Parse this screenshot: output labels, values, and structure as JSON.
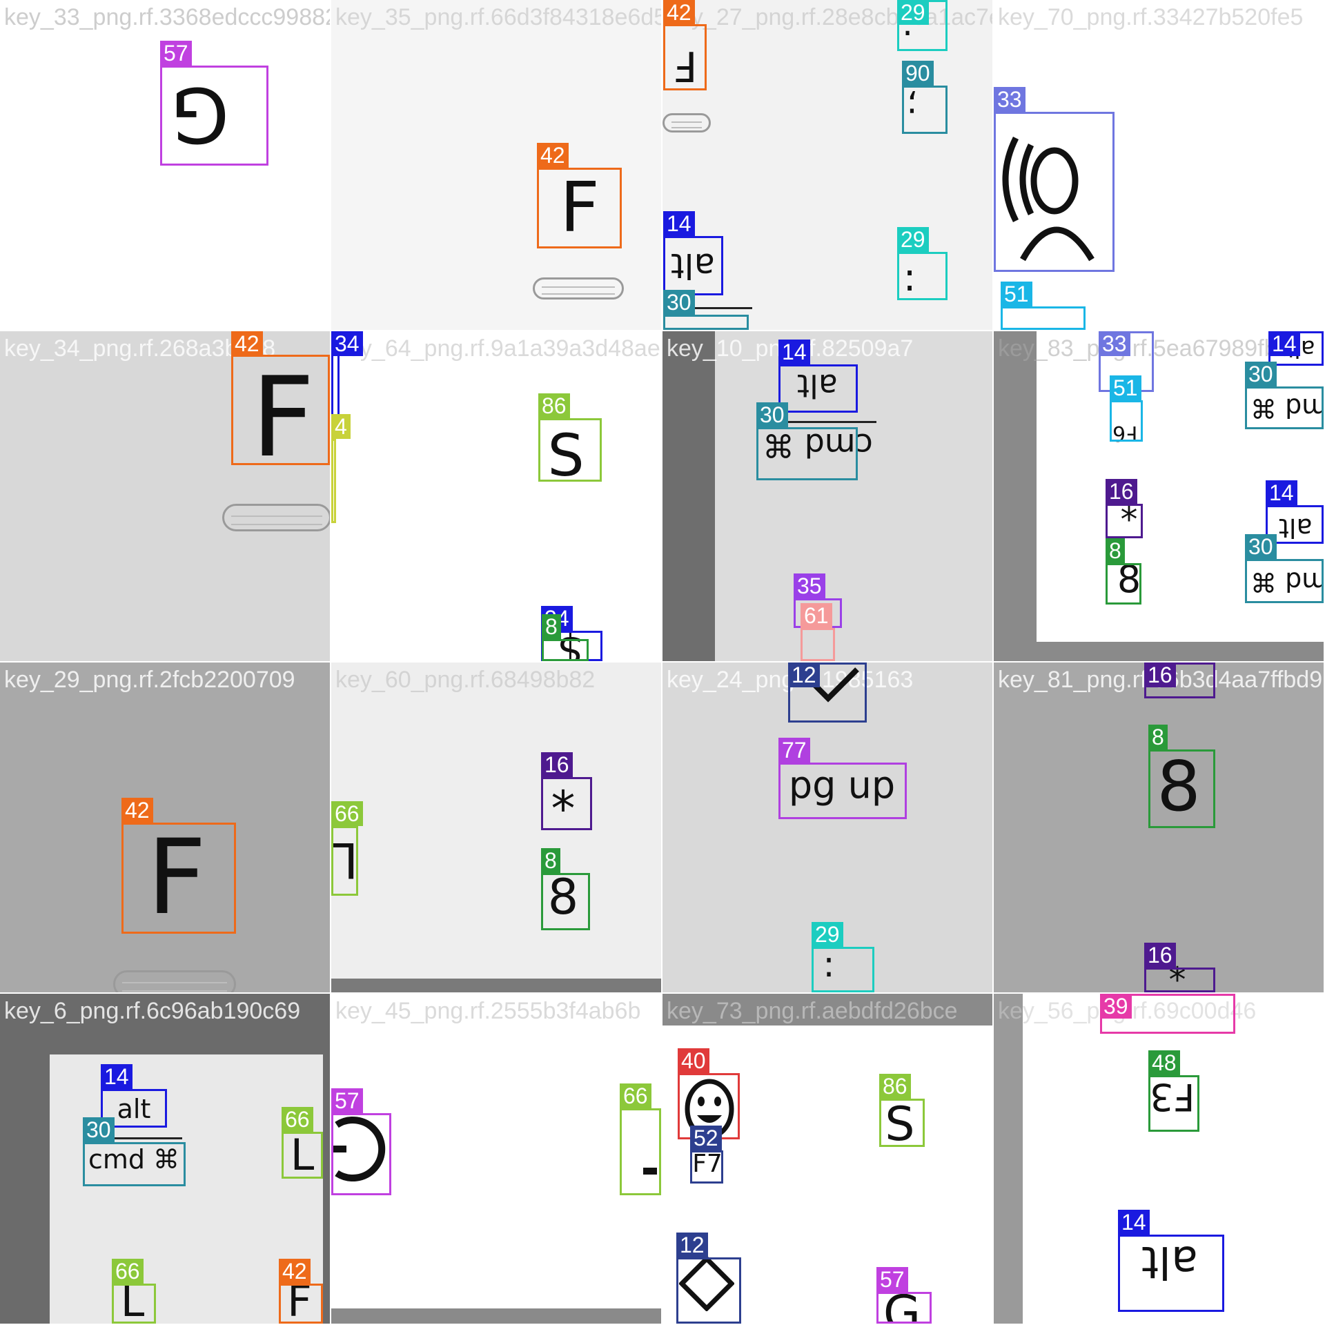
{
  "tiles": [
    {
      "filename": "key_33_png.rf.3368edccc99882.36a"
    },
    {
      "filename": "key_35_png.rf.66d3f84318e6d5f0b2898"
    },
    {
      "filename": "key_27_png.rf.28e8cb23a1ac7e325"
    },
    {
      "filename": "key_70_png.rf.33427b520fe5"
    },
    {
      "filename": "key_34_png.rf.268a3bec8"
    },
    {
      "filename": "key_64_png.rf.9a1a39a3d48ae5"
    },
    {
      "filename": "key_10_png.rf.82509a7"
    },
    {
      "filename": "key_83_png.rf.5ea67989fbb"
    },
    {
      "filename": "key_29_png.rf.2fcb2200709"
    },
    {
      "filename": "key_60_png.rf.68498b82"
    },
    {
      "filename": "key_24_png.rf.1985163"
    },
    {
      "filename": "key_81_png.rf.86b3d4aa7ffbd9"
    },
    {
      "filename": "key_6_png.rf.6c96ab190c69"
    },
    {
      "filename": "key_45_png.rf.2555b3f4ab6b"
    },
    {
      "filename": "key_73_png.rf.aebdfd26bce"
    },
    {
      "filename": "key_56_png.rf.69c00d46"
    }
  ],
  "detections": [
    {
      "label": "57",
      "glyph": "G",
      "color": "#c040e0"
    },
    {
      "label": "42",
      "glyph": "F",
      "color": "#ee6a1a"
    },
    {
      "label": "42",
      "glyph": "F",
      "color": "#ee6a1a"
    },
    {
      "label": "29",
      "glyph": ":",
      "color": "#1ccdc0"
    },
    {
      "label": "90",
      "glyph": ";",
      "color": "#2a8da0"
    },
    {
      "label": "14",
      "glyph": "alt",
      "color": "#1a1ae0"
    },
    {
      "label": "30",
      "glyph": "",
      "color": "#2a8da0"
    },
    {
      "label": "29",
      "glyph": ":",
      "color": "#1ccdc0"
    },
    {
      "label": "33",
      "glyph": "(O",
      "color": "#6f76e0"
    },
    {
      "label": "51",
      "glyph": "",
      "color": "#1ab6e6"
    },
    {
      "label": "33",
      "glyph": "",
      "color": "#6f76e0"
    },
    {
      "label": "14",
      "glyph": "alt",
      "color": "#1a1ae0"
    },
    {
      "label": "42",
      "glyph": "F",
      "color": "#ee6a1a"
    },
    {
      "label": "34",
      "glyph": "",
      "color": "#1a1ae0"
    },
    {
      "label": "4",
      "glyph": "",
      "color": "#c8d23a"
    },
    {
      "label": "86",
      "glyph": "S",
      "color": "#8cc83a"
    },
    {
      "label": "34",
      "glyph": "$",
      "color": "#1a1ae0"
    },
    {
      "label": "8",
      "glyph": "8",
      "color": "#2a9a3a"
    },
    {
      "label": "14",
      "glyph": "alt",
      "color": "#1a1ae0"
    },
    {
      "label": "30",
      "glyph": "cmd ⌘",
      "color": "#2a8da0"
    },
    {
      "label": "35",
      "glyph": "—",
      "color": "#9a40e8"
    },
    {
      "label": "61",
      "glyph": "",
      "color": "#f59a9a"
    },
    {
      "label": "12",
      "glyph": "◇",
      "color": "#2d3f8f"
    },
    {
      "label": "51",
      "glyph": "F6",
      "color": "#1ab6e6"
    },
    {
      "label": "30",
      "glyph": "cmd ⌘",
      "color": "#2a8da0"
    },
    {
      "label": "16",
      "glyph": "*",
      "color": "#4e1a8f"
    },
    {
      "label": "8",
      "glyph": "8",
      "color": "#2a9a3a"
    },
    {
      "label": "14",
      "glyph": "alt",
      "color": "#1a1ae0"
    },
    {
      "label": "30",
      "glyph": "cmd ⌘",
      "color": "#2a8da0"
    },
    {
      "label": "16",
      "glyph": "*",
      "color": "#4e1a8f"
    },
    {
      "label": "42",
      "glyph": "F",
      "color": "#ee6a1a"
    },
    {
      "label": "66",
      "glyph": "L",
      "color": "#8cc83a"
    },
    {
      "label": "16",
      "glyph": "*",
      "color": "#4e1a8f"
    },
    {
      "label": "8",
      "glyph": "8",
      "color": "#2a9a3a"
    },
    {
      "label": "77",
      "glyph": "pg up",
      "color": "#b040e0"
    },
    {
      "label": "29",
      "glyph": ":",
      "color": "#1ccdc0"
    },
    {
      "label": "8",
      "glyph": "8",
      "color": "#2a9a3a"
    },
    {
      "label": "16",
      "glyph": "*",
      "color": "#4e1a8f"
    },
    {
      "label": "39",
      "glyph": "",
      "color": "#e63aa8"
    },
    {
      "label": "14",
      "glyph": "alt",
      "color": "#1a1ae0"
    },
    {
      "label": "30",
      "glyph": "cmd ⌘",
      "color": "#2a8da0"
    },
    {
      "label": "66",
      "glyph": "L",
      "color": "#8cc83a"
    },
    {
      "label": "66",
      "glyph": "L",
      "color": "#8cc83a"
    },
    {
      "label": "42",
      "glyph": "F",
      "color": "#ee6a1a"
    },
    {
      "label": "57",
      "glyph": "G",
      "color": "#c040e0"
    },
    {
      "label": "66",
      "glyph": "L",
      "color": "#8cc83a"
    },
    {
      "label": "40",
      "glyph": "☺",
      "color": "#e03a3a"
    },
    {
      "label": "52",
      "glyph": "F7",
      "color": "#2d3f8f"
    },
    {
      "label": "86",
      "glyph": "S",
      "color": "#8cc83a"
    },
    {
      "label": "12",
      "glyph": "◇",
      "color": "#2d3f8f"
    },
    {
      "label": "57",
      "glyph": "G",
      "color": "#c040e0"
    },
    {
      "label": "48",
      "glyph": "F3",
      "color": "#2a9a3a"
    },
    {
      "label": "14",
      "glyph": "alt",
      "color": "#1a1ae0"
    }
  ]
}
